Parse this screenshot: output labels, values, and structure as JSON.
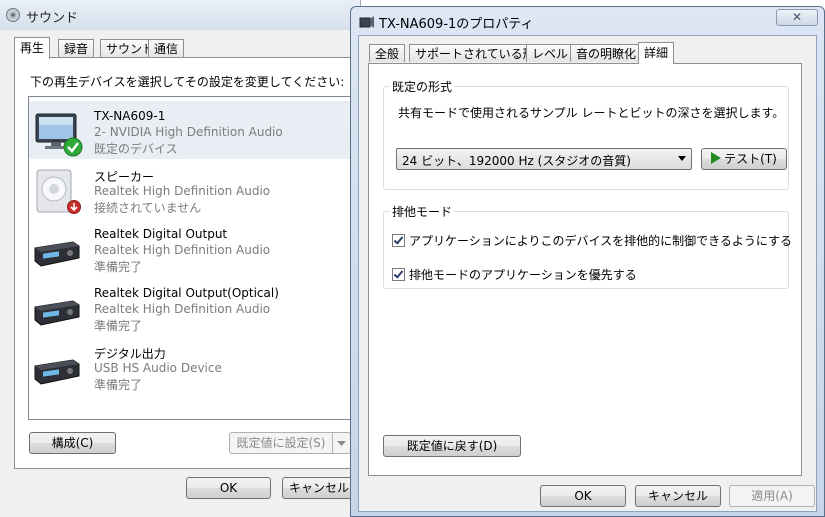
{
  "sound_dialog": {
    "title": "サウンド",
    "tabs": [
      "再生",
      "録音",
      "サウンド",
      "通信"
    ],
    "active_tab": 0,
    "instruction": "下の再生デバイスを選択してその設定を変更してください:",
    "devices": [
      {
        "name": "TX-NA609-1",
        "desc": "2- NVIDIA High Definition Audio",
        "status": "既定のデバイス",
        "icon": "monitor-icon",
        "badge": "default-check-icon"
      },
      {
        "name": "スピーカー",
        "desc": "Realtek High Definition Audio",
        "status": "接続されていません",
        "icon": "speaker-icon",
        "badge": "unplugged-icon"
      },
      {
        "name": "Realtek Digital Output",
        "desc": "Realtek High Definition Audio",
        "status": "準備完了",
        "icon": "receiver-icon"
      },
      {
        "name": "Realtek Digital Output(Optical)",
        "desc": "Realtek High Definition Audio",
        "status": "準備完了",
        "icon": "receiver-icon"
      },
      {
        "name": "デジタル出力",
        "desc": "USB HS Audio Device",
        "status": "準備完了",
        "icon": "receiver-icon"
      }
    ],
    "configure_label": "構成(C)",
    "set_default_label": "既定値に設定(S)",
    "ok_label": "OK",
    "cancel_label": "キャンセル"
  },
  "properties_dialog": {
    "title": "TX-NA609-1のプロパティ",
    "close_label": "✕",
    "tabs": [
      "全般",
      "サポートされている形式",
      "レベル",
      "音の明瞭化",
      "詳細"
    ],
    "active_tab": 4,
    "default_format": {
      "label": "既定の形式",
      "description": "共有モードで使用されるサンプル レートとビットの深さを選択します。",
      "selected": "24 ビット、192000 Hz (スタジオの音質)",
      "test_label": "テスト(T)"
    },
    "exclusive_mode": {
      "label": "排他モード",
      "options": [
        {
          "label": "アプリケーションによりこのデバイスを排他的に制御できるようにする",
          "checked": true
        },
        {
          "label": "排他モードのアプリケーションを優先する",
          "checked": true
        }
      ]
    },
    "restore_defaults_label": "既定値に戻す(D)",
    "ok_label": "OK",
    "cancel_label": "キャンセル",
    "apply_label": "適用(A)"
  },
  "colors": {
    "accent_check": "#2fa83a",
    "play_green": "#1f8a1f",
    "selection_bg": "#e8eef4"
  }
}
